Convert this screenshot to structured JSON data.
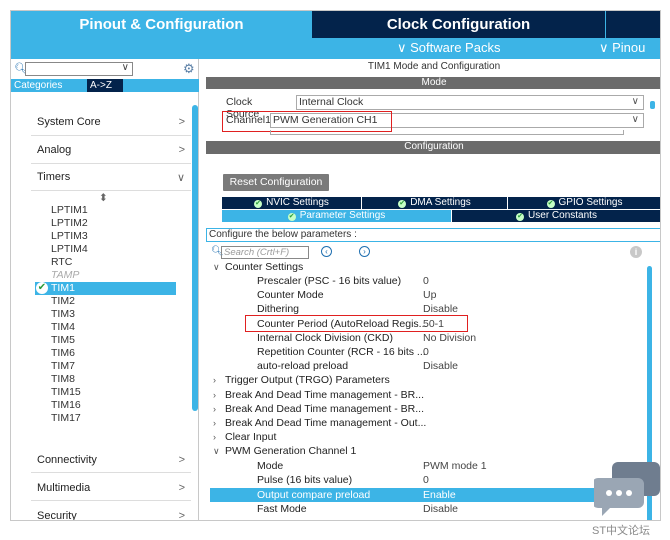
{
  "tabs": {
    "pinout": "Pinout & Configuration",
    "clock": "Clock Configuration",
    "more": ""
  },
  "subbar": {
    "software_packs": "∨ Software Packs",
    "pinout": "∨ Pinou"
  },
  "left": {
    "category_tabs": [
      "Categories",
      "A->Z"
    ],
    "categories": [
      {
        "label": "System Core",
        "chevron": ">"
      },
      {
        "label": "Analog",
        "chevron": ">"
      },
      {
        "label": "Timers",
        "chevron": "∨"
      },
      {
        "label": "Connectivity",
        "chevron": ">"
      },
      {
        "label": "Multimedia",
        "chevron": ">"
      },
      {
        "label": "Security",
        "chevron": ">"
      }
    ],
    "sort_glyph": "⬍",
    "timers": [
      "LPTIM1",
      "LPTIM2",
      "LPTIM3",
      "LPTIM4",
      "RTC",
      "TAMP",
      "TIM1",
      "TIM2",
      "TIM3",
      "TIM4",
      "TIM5",
      "TIM6",
      "TIM7",
      "TIM8",
      "TIM15",
      "TIM16",
      "TIM17"
    ],
    "selected_timer": "TIM1",
    "dim_timer": "TAMP"
  },
  "right": {
    "title": "TIM1 Mode and Configuration",
    "mode_header": "Mode",
    "clock_source_label": "Clock Source",
    "clock_source_value": "Internal Clock",
    "channel1_label": "Channel1",
    "channel1_value": "PWM Generation CH1",
    "configuration_header": "Configuration",
    "reset_button": "Reset Configuration",
    "settings_tabs": [
      "NVIC Settings",
      "DMA Settings",
      "GPIO Settings",
      "Parameter Settings",
      "User Constants"
    ],
    "configure_label": "Configure the below parameters :",
    "search_placeholder": "Search (Crtl+F)",
    "counter_settings": "Counter Settings",
    "params": [
      {
        "name": "Prescaler (PSC - 16 bits value)",
        "value": "0"
      },
      {
        "name": "Counter Mode",
        "value": "Up"
      },
      {
        "name": "Dithering",
        "value": "Disable"
      },
      {
        "name": "Counter Period (AutoReload Regis...",
        "value": "50-1"
      },
      {
        "name": "Internal Clock Division (CKD)",
        "value": "No Division"
      },
      {
        "name": "Repetition Counter (RCR - 16 bits ...",
        "value": "0"
      },
      {
        "name": "auto-reload preload",
        "value": "Disable"
      }
    ],
    "groups": [
      "Trigger Output (TRGO) Parameters",
      "Break And Dead Time management - BR...",
      "Break And Dead Time management - BR...",
      "Break And Dead Time management - Out...",
      "Clear Input"
    ],
    "pwm_group": "PWM Generation Channel 1",
    "pwm_params": [
      {
        "name": "Mode",
        "value": "PWM mode 1"
      },
      {
        "name": "Pulse (16 bits value)",
        "value": "0"
      },
      {
        "name": "Output compare preload",
        "value": "Enable"
      },
      {
        "name": "Fast Mode",
        "value": "Disable"
      }
    ]
  },
  "watermark": {
    "text": "ST中文论坛"
  },
  "colors": {
    "accent": "#3cb4e6",
    "dark": "#03234b",
    "highlight_box": "#e02020"
  }
}
